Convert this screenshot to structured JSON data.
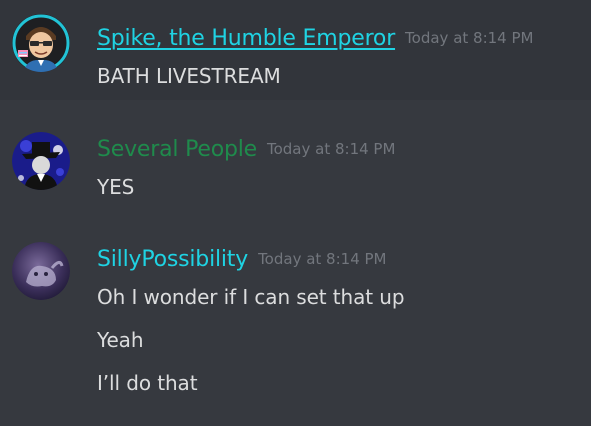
{
  "messages": [
    {
      "username": "Spike, the Humble Emperor",
      "username_color": "#1fd3e3",
      "timestamp": "Today at 8:14 PM",
      "lines": [
        "BATH LIVESTREAM"
      ]
    },
    {
      "username": "Several People",
      "username_color": "#1f8b4c",
      "timestamp": "Today at 8:14 PM",
      "lines": [
        "YES"
      ]
    },
    {
      "username": "SillyPossibility",
      "username_color": "#1fd3e3",
      "timestamp": "Today at 8:14 PM",
      "lines": [
        "Oh I wonder if I can set that up",
        "Yeah",
        "I’ll do that"
      ]
    }
  ],
  "colors": {
    "background": "#36393f",
    "hover_background": "#32353b",
    "text": "#dcddde",
    "timestamp": "#72767d"
  }
}
